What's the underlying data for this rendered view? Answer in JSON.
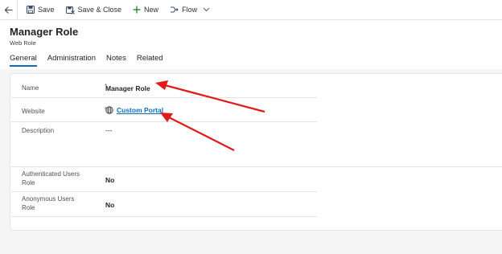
{
  "toolbar": {
    "save_label": "Save",
    "save_close_label": "Save & Close",
    "new_label": "New",
    "flow_label": "Flow"
  },
  "header": {
    "title": "Manager Role",
    "entity": "Web Role"
  },
  "tabs": [
    {
      "label": "General",
      "active": true
    },
    {
      "label": "Administration",
      "active": false
    },
    {
      "label": "Notes",
      "active": false
    },
    {
      "label": "Related",
      "active": false
    }
  ],
  "form": {
    "name": {
      "label": "Name",
      "required_mark": "*",
      "value": "Manager Role"
    },
    "website": {
      "label": "Website",
      "required_mark": "*",
      "value": "Custom Portal"
    },
    "description": {
      "label": "Description",
      "value": "---"
    },
    "authenticated": {
      "label_line1": "Authenticated Users",
      "label_line2": "Role",
      "value": "No"
    },
    "anonymous": {
      "label_line1": "Anonymous Users",
      "label_line2": "Role",
      "value": "No"
    }
  },
  "colors": {
    "accent": "#0f6cbd",
    "required": "#c4314b",
    "annotation_arrow": "#e01b1b"
  },
  "icons": {
    "back": "back-arrow-icon",
    "save": "floppy-disk-icon",
    "save_close": "save-close-icon",
    "new": "plus-icon",
    "flow": "flow-icon",
    "dropdown": "chevron-down-icon",
    "lookup": "globe-icon"
  }
}
